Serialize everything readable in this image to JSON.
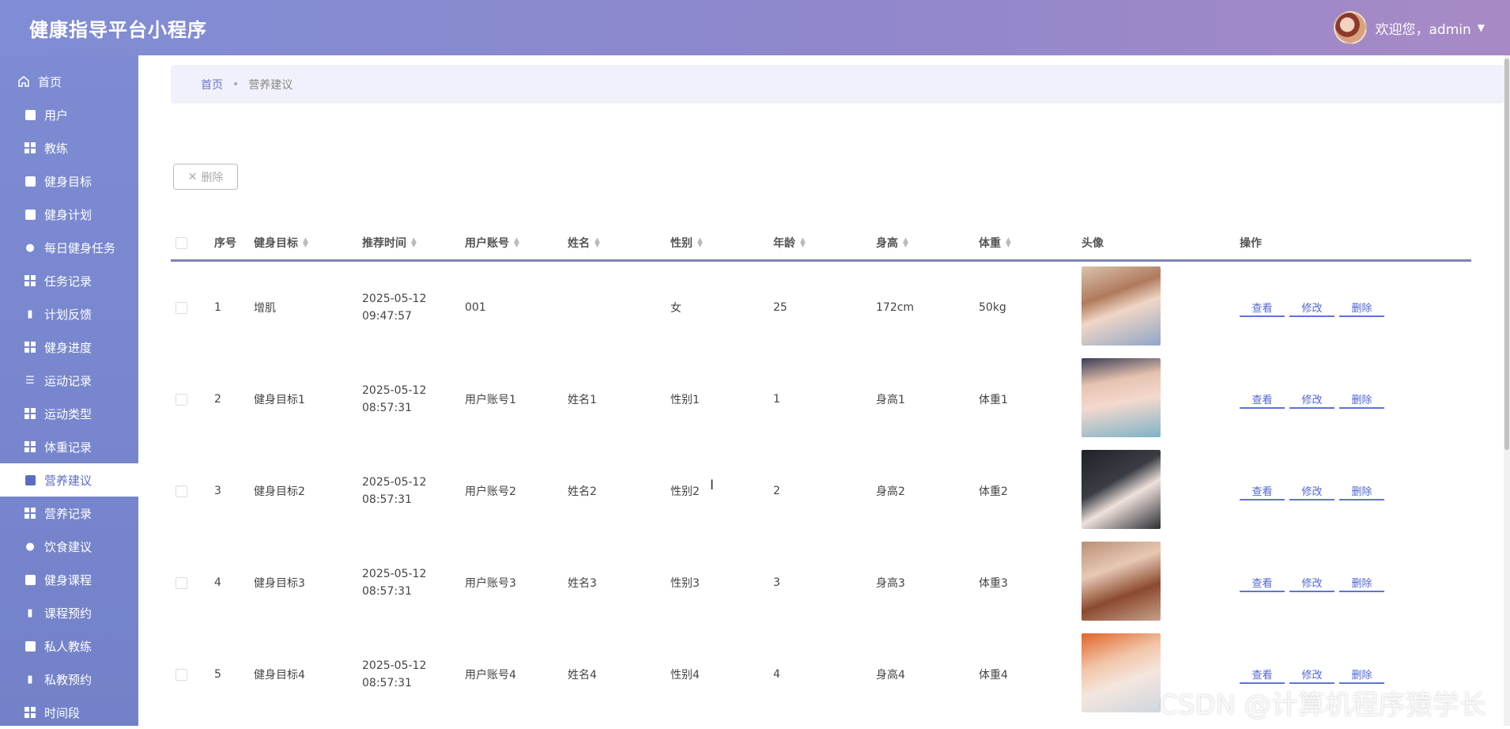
{
  "app": {
    "title": "健康指导平台小程序"
  },
  "user": {
    "greeting": "欢迎您，admin"
  },
  "sidebar": {
    "items": [
      {
        "label": "首页",
        "icon": "home-icon"
      },
      {
        "label": "用户",
        "icon": "clipboard-icon"
      },
      {
        "label": "教练",
        "icon": "grid-icon"
      },
      {
        "label": "健身目标",
        "icon": "briefcase-icon"
      },
      {
        "label": "健身计划",
        "icon": "chat-icon"
      },
      {
        "label": "每日健身任务",
        "icon": "bulb-icon"
      },
      {
        "label": "任务记录",
        "icon": "grid-icon"
      },
      {
        "label": "计划反馈",
        "icon": "brush-icon"
      },
      {
        "label": "健身进度",
        "icon": "table-icon"
      },
      {
        "label": "运动记录",
        "icon": "list-icon"
      },
      {
        "label": "运动类型",
        "icon": "grid-icon"
      },
      {
        "label": "体重记录",
        "icon": "grid-icon"
      },
      {
        "label": "营养建议",
        "icon": "monitor-icon"
      },
      {
        "label": "营养记录",
        "icon": "grid-icon"
      },
      {
        "label": "饮食建议",
        "icon": "person-icon"
      },
      {
        "label": "健身课程",
        "icon": "checklist-icon"
      },
      {
        "label": "课程预约",
        "icon": "barchart-icon"
      },
      {
        "label": "私人教练",
        "icon": "money-icon"
      },
      {
        "label": "私教预约",
        "icon": "book-icon"
      },
      {
        "label": "时间段",
        "icon": "grid-icon"
      }
    ],
    "active_label": "营养建议"
  },
  "breadcrumb": {
    "home": "首页",
    "separator": "•",
    "current": "营养建议"
  },
  "toolbar": {
    "delete_label": "删除"
  },
  "table": {
    "headers": {
      "index": "序号",
      "goal": "健身目标",
      "time": "推荐时间",
      "account": "用户账号",
      "name": "姓名",
      "gender": "性别",
      "age": "年龄",
      "height": "身高",
      "weight": "体重",
      "avatar": "头像",
      "actions": "操作"
    },
    "action_labels": {
      "view": "查看",
      "edit": "修改",
      "delete": "删除"
    },
    "rows": [
      {
        "index": "1",
        "goal": "增肌",
        "time": "2025-05-12 09:47:57",
        "account": "001",
        "name": "",
        "gender": "女",
        "age": "25",
        "height": "172cm",
        "weight": "50kg"
      },
      {
        "index": "2",
        "goal": "健身目标1",
        "time": "2025-05-12 08:57:31",
        "account": "用户账号1",
        "name": "姓名1",
        "gender": "性别1",
        "age": "1",
        "height": "身高1",
        "weight": "体重1"
      },
      {
        "index": "3",
        "goal": "健身目标2",
        "time": "2025-05-12 08:57:31",
        "account": "用户账号2",
        "name": "姓名2",
        "gender": "性别2",
        "age": "2",
        "height": "身高2",
        "weight": "体重2"
      },
      {
        "index": "4",
        "goal": "健身目标3",
        "time": "2025-05-12 08:57:31",
        "account": "用户账号3",
        "name": "姓名3",
        "gender": "性别3",
        "age": "3",
        "height": "身高3",
        "weight": "体重3"
      },
      {
        "index": "5",
        "goal": "健身目标4",
        "time": "2025-05-12 08:57:31",
        "account": "用户账号4",
        "name": "姓名4",
        "gender": "性别4",
        "age": "4",
        "height": "身高4",
        "weight": "体重4"
      }
    ]
  },
  "watermark": "CSDN @计算机程序猿学长"
}
